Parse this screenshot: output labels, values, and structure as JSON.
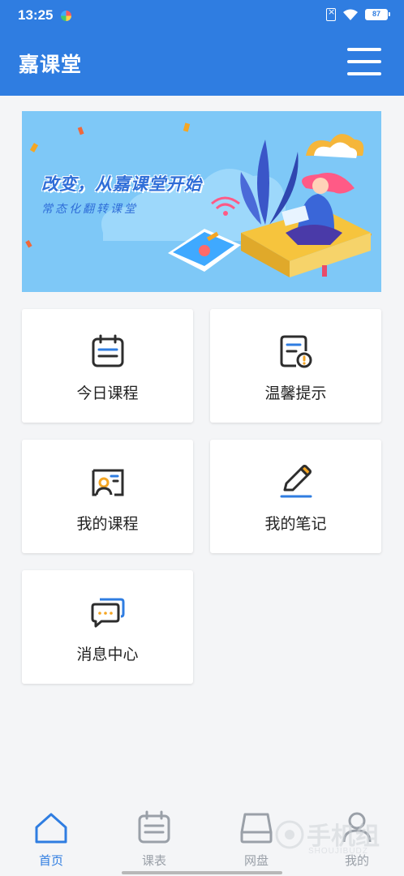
{
  "status_bar": {
    "time": "13:25",
    "battery": "87"
  },
  "header": {
    "title": "嘉课堂"
  },
  "banner": {
    "headline": "改变，从嘉课堂开始",
    "subline": "常态化翻转课堂"
  },
  "cards": [
    {
      "label": "今日课程",
      "icon": "calendar-icon"
    },
    {
      "label": "温馨提示",
      "icon": "notice-document-icon"
    },
    {
      "label": "我的课程",
      "icon": "teacher-board-icon"
    },
    {
      "label": "我的笔记",
      "icon": "pen-icon"
    },
    {
      "label": "消息中心",
      "icon": "chat-bubbles-icon"
    }
  ],
  "bottom_nav": [
    {
      "label": "首页",
      "icon": "home-icon",
      "active": true
    },
    {
      "label": "课表",
      "icon": "calendar-icon",
      "active": false
    },
    {
      "label": "网盘",
      "icon": "cloud-drive-icon",
      "active": false
    },
    {
      "label": "我的",
      "icon": "user-icon",
      "active": false
    }
  ],
  "watermark": {
    "text": "手机组",
    "sub": "SHOUJIBUDZ"
  },
  "colors": {
    "primary": "#2f7de1",
    "banner_bg": "#7ec8f7",
    "page_bg": "#f4f5f7",
    "icon_dark": "#2d2d2d",
    "icon_accent": "#2f7de1",
    "icon_warn": "#f5a623"
  }
}
